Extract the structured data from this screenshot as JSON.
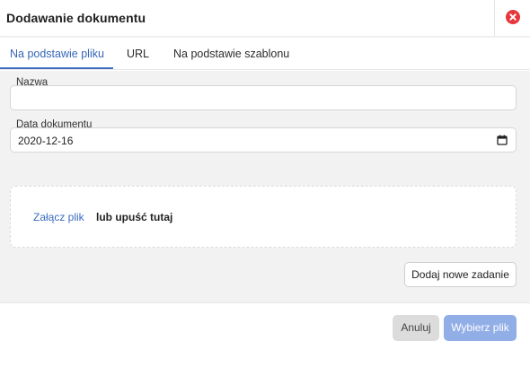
{
  "dialog": {
    "title": "Dodawanie dokumentu",
    "close_icon": "close-circle-icon",
    "accent_color": "#3f6fc4",
    "close_color": "#e5373c"
  },
  "tabs": [
    {
      "label": "Na podstawie pliku",
      "active": true
    },
    {
      "label": "URL",
      "active": false
    },
    {
      "label": "Na podstawie szablonu",
      "active": false
    }
  ],
  "form": {
    "name_label": "Nazwa",
    "name_value": "",
    "date_label": "Data dokumentu",
    "date_value": "2020-12-16",
    "date_icon": "calendar-icon"
  },
  "dropzone": {
    "attach_link": "Załącz plik",
    "drop_text": "lub upuść tutaj"
  },
  "actions": {
    "add_task": "Dodaj nowe zadanie",
    "cancel": "Anuluj",
    "choose_file": "Wybierz plik",
    "primary_color": "#91aee7"
  }
}
